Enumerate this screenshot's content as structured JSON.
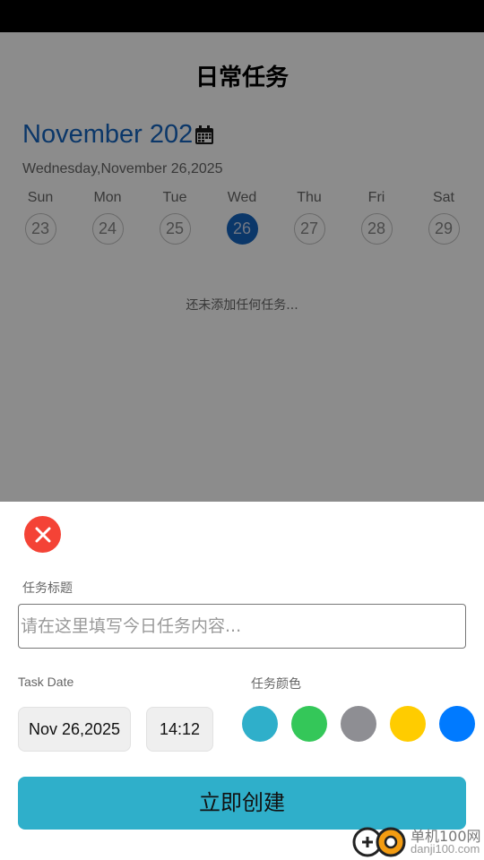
{
  "header": {
    "title": "日常任务"
  },
  "calendar": {
    "month_label": "November 202",
    "selected_date_text": "Wednesday,November 26,2025",
    "days": [
      {
        "name": "Sun",
        "num": "23"
      },
      {
        "name": "Mon",
        "num": "24"
      },
      {
        "name": "Tue",
        "num": "25"
      },
      {
        "name": "Wed",
        "num": "26"
      },
      {
        "name": "Thu",
        "num": "27"
      },
      {
        "name": "Fri",
        "num": "28"
      },
      {
        "name": "Sat",
        "num": "29"
      }
    ],
    "selected_index": 3,
    "accent_color": "#1565C0"
  },
  "task_list": {
    "empty_message": "还未添加任何任务..."
  },
  "sheet": {
    "title_label": "任务标题",
    "title_placeholder": "请在这里填写今日任务内容...",
    "date_label": "Task Date",
    "date_value": "Nov 26,2025",
    "time_value": "14:12",
    "color_label": "任务颜色",
    "colors": [
      "#2fafca",
      "#34c759",
      "#8e8e93",
      "#ffcc00",
      "#007aff"
    ],
    "create_label": "立即创建",
    "close_icon": "close-icon"
  },
  "watermark": {
    "line1": "单机100网",
    "line2": "danji100.com"
  }
}
